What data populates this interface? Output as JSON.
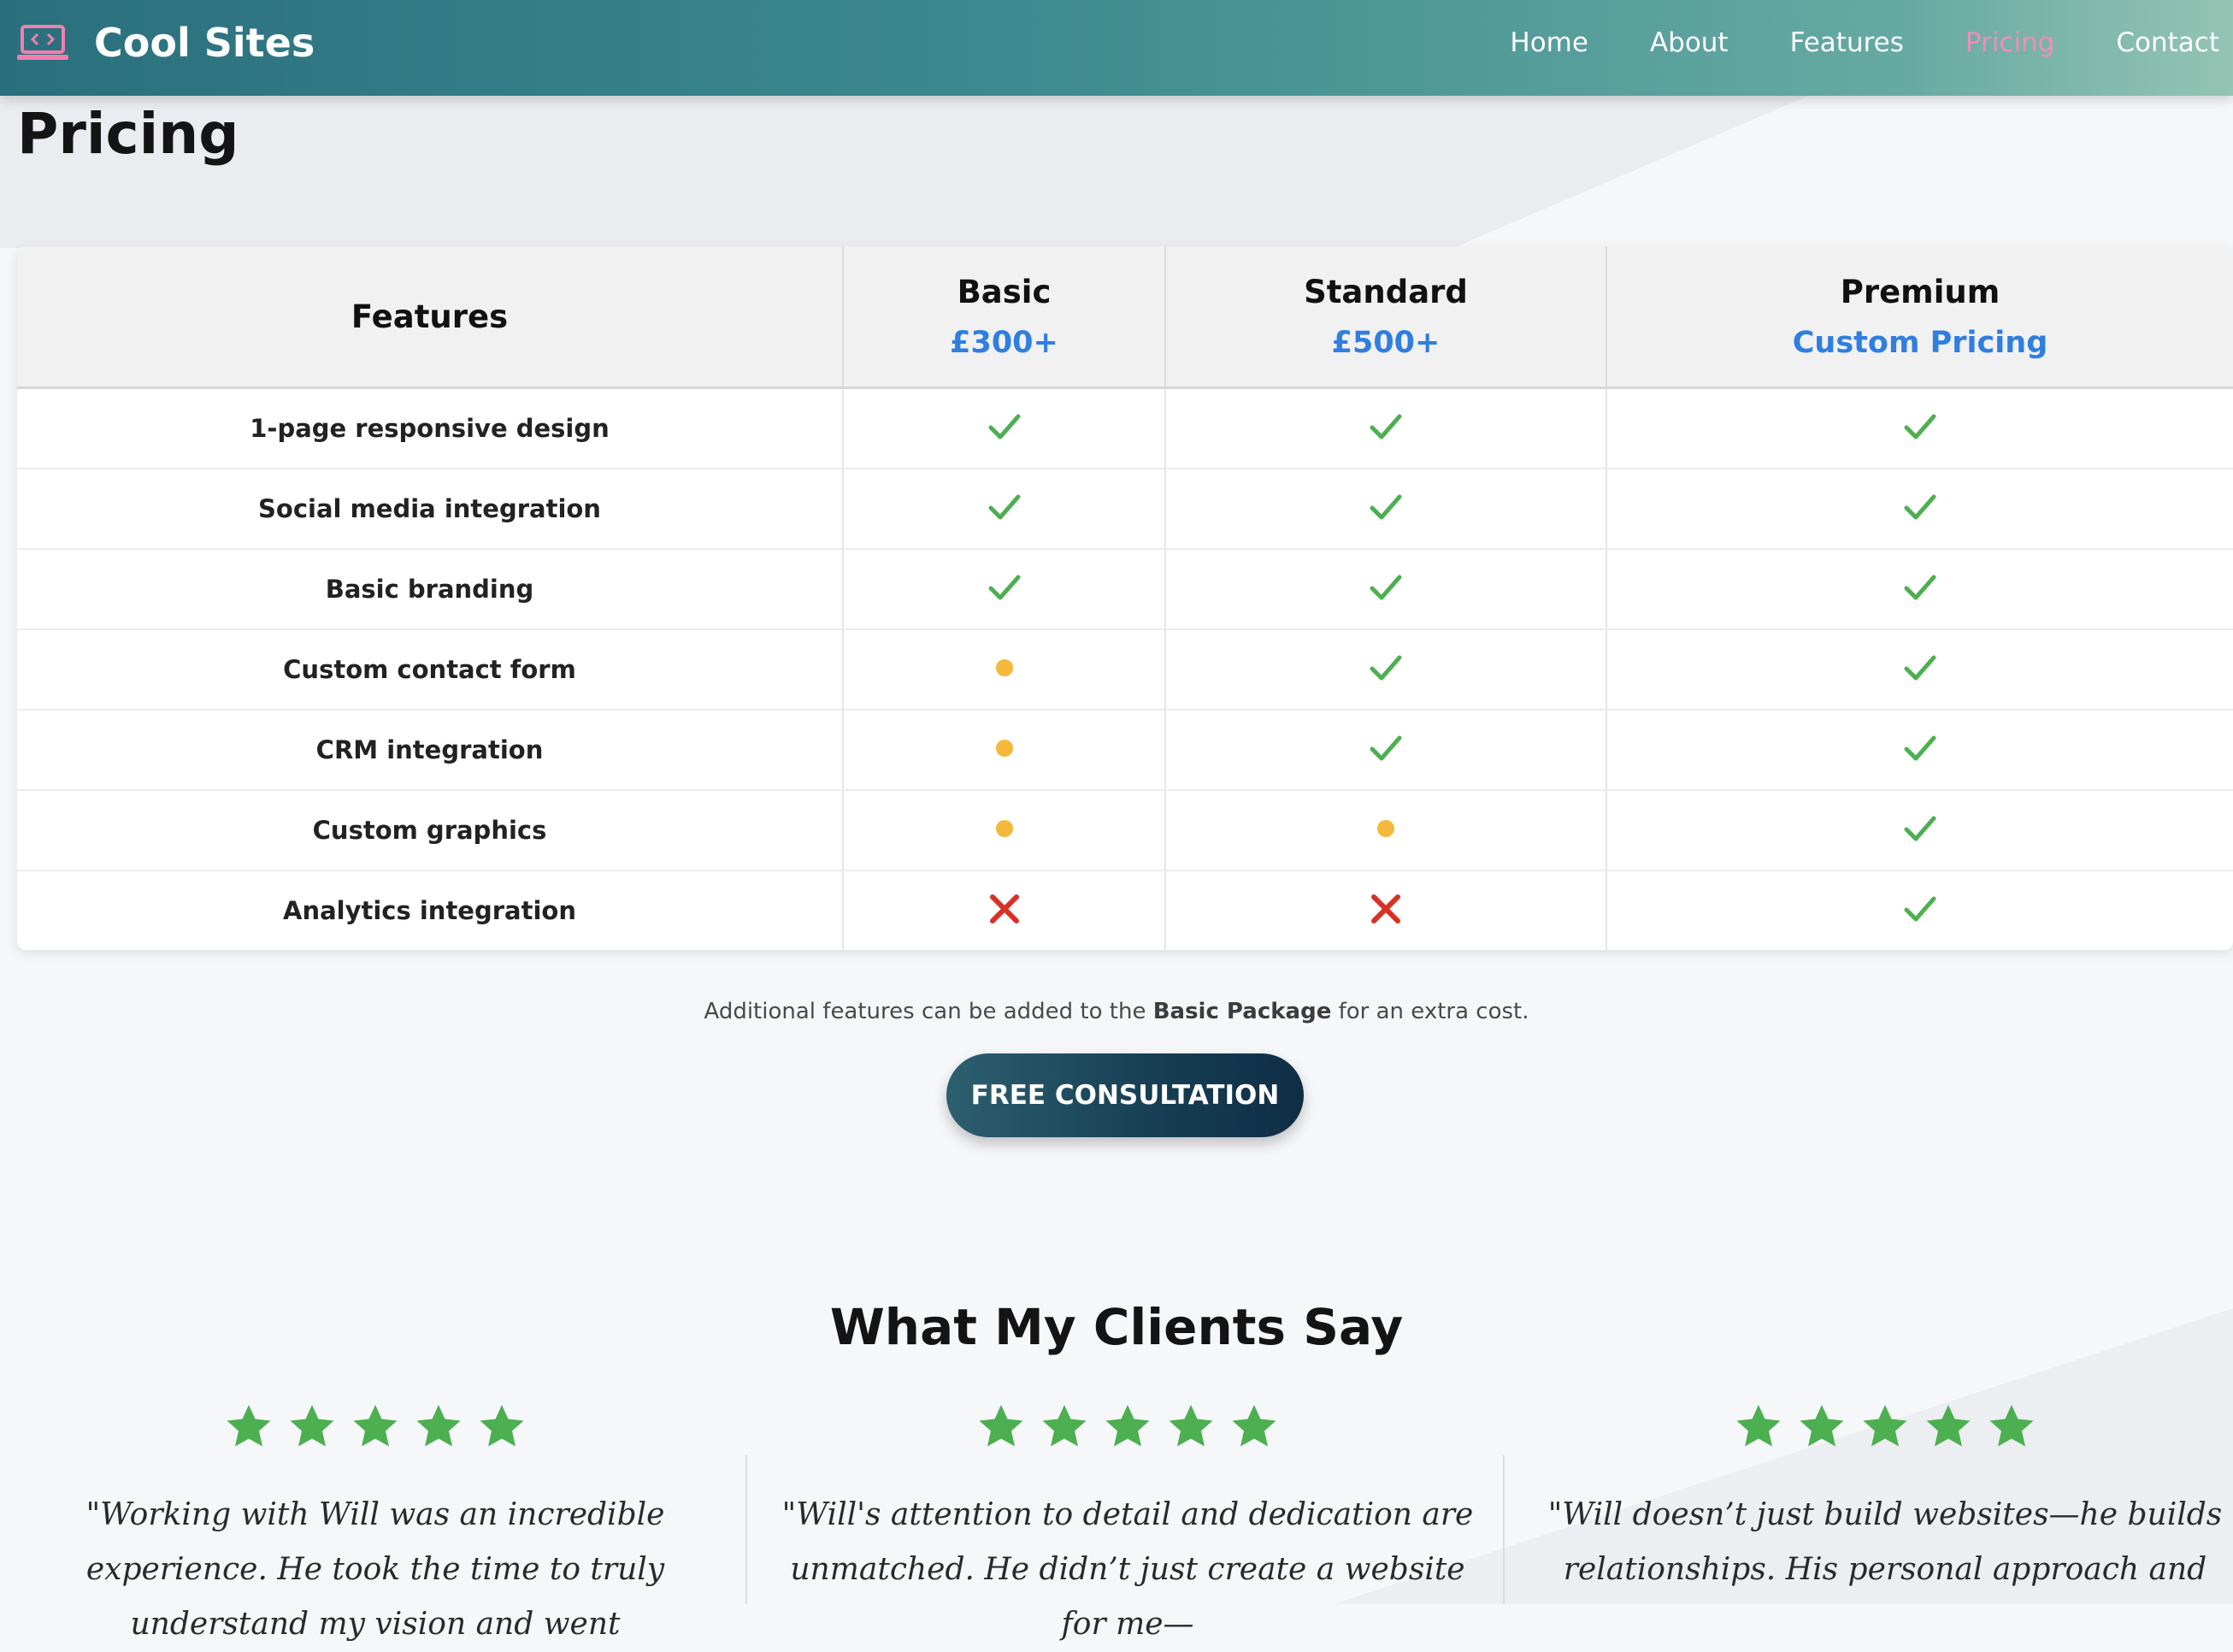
{
  "header": {
    "brand": "Cool Sites",
    "nav": [
      {
        "label": "Home",
        "active": false
      },
      {
        "label": "About",
        "active": false
      },
      {
        "label": "Features",
        "active": false
      },
      {
        "label": "Pricing",
        "active": true
      },
      {
        "label": "Contact",
        "active": false
      }
    ]
  },
  "page_title": "Pricing",
  "pricing_table": {
    "feature_header": "Features",
    "plans": [
      {
        "name": "Basic",
        "price": "£300+"
      },
      {
        "name": "Standard",
        "price": "£500+"
      },
      {
        "name": "Premium",
        "price": "Custom Pricing"
      }
    ],
    "rows": [
      {
        "feature": "1-page responsive design",
        "values": [
          "check",
          "check",
          "check"
        ]
      },
      {
        "feature": "Social media integration",
        "values": [
          "check",
          "check",
          "check"
        ]
      },
      {
        "feature": "Basic branding",
        "values": [
          "check",
          "check",
          "check"
        ]
      },
      {
        "feature": "Custom contact form",
        "values": [
          "partial",
          "check",
          "check"
        ]
      },
      {
        "feature": "CRM integration",
        "values": [
          "partial",
          "check",
          "check"
        ]
      },
      {
        "feature": "Custom graphics",
        "values": [
          "partial",
          "partial",
          "check"
        ]
      },
      {
        "feature": "Analytics integration",
        "values": [
          "cross",
          "cross",
          "check"
        ]
      }
    ]
  },
  "note": {
    "before": "Additional features can be added to the ",
    "bold": "Basic Package",
    "after": " for an extra cost."
  },
  "cta_label": "FREE CONSULTATION",
  "testimonials_title": "What My Clients Say",
  "testimonials": [
    {
      "stars": 5,
      "quote": "\"Working with Will was an incredible experience. He took the time to truly understand my vision and went"
    },
    {
      "stars": 5,
      "quote": "\"Will's attention to detail and dedication are unmatched. He didn’t just create a website for me—"
    },
    {
      "stars": 5,
      "quote": "\"Will doesn’t just build websites—he builds relationships. His personal approach and"
    }
  ],
  "colors": {
    "accent_blue": "#2f7ee0",
    "active_nav": "#f18db6",
    "check": "#4caf50",
    "partial": "#f4b93a",
    "cross": "#d93025",
    "star": "#4caf50"
  },
  "icons": {
    "brand": "laptop-code-icon",
    "included": "check-icon",
    "partial": "dot-icon",
    "excluded": "cross-icon",
    "rating": "star-icon"
  }
}
